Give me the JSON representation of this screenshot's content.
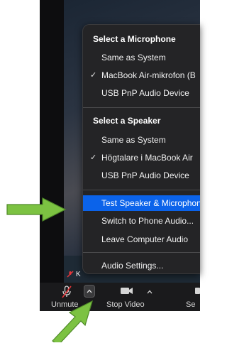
{
  "menu": {
    "microphone_header": "Select a Microphone",
    "microphone_items": [
      {
        "label": "Same as System",
        "checked": false
      },
      {
        "label": "MacBook Air-mikrofon (B",
        "checked": true
      },
      {
        "label": "USB PnP Audio Device",
        "checked": false
      }
    ],
    "speaker_header": "Select a Speaker",
    "speaker_items": [
      {
        "label": "Same as System",
        "checked": false
      },
      {
        "label": "Högtalare i MacBook Air",
        "checked": true
      },
      {
        "label": "USB PnP Audio Device",
        "checked": false
      }
    ],
    "test_item": "Test Speaker & Microphone",
    "switch_item": "Switch to Phone Audio...",
    "leave_item": "Leave Computer Audio",
    "settings_item": "Audio Settings..."
  },
  "video": {
    "participant_label": "K"
  },
  "toolbar": {
    "unmute_label": "Unmute",
    "stop_video_label": "Stop Video",
    "share_label": "Se"
  },
  "colors": {
    "menu_bg": "#242426",
    "highlight": "#0b63ea",
    "arrow": "#7cc242",
    "mute_red": "#e8363a"
  },
  "icons": {
    "mic_off": "mic-off-icon",
    "caret_up": "caret-up-icon",
    "video_camera": "video-camera-icon",
    "checkmark": "checkmark-icon",
    "annotation_arrow": "green-arrow-icon"
  }
}
